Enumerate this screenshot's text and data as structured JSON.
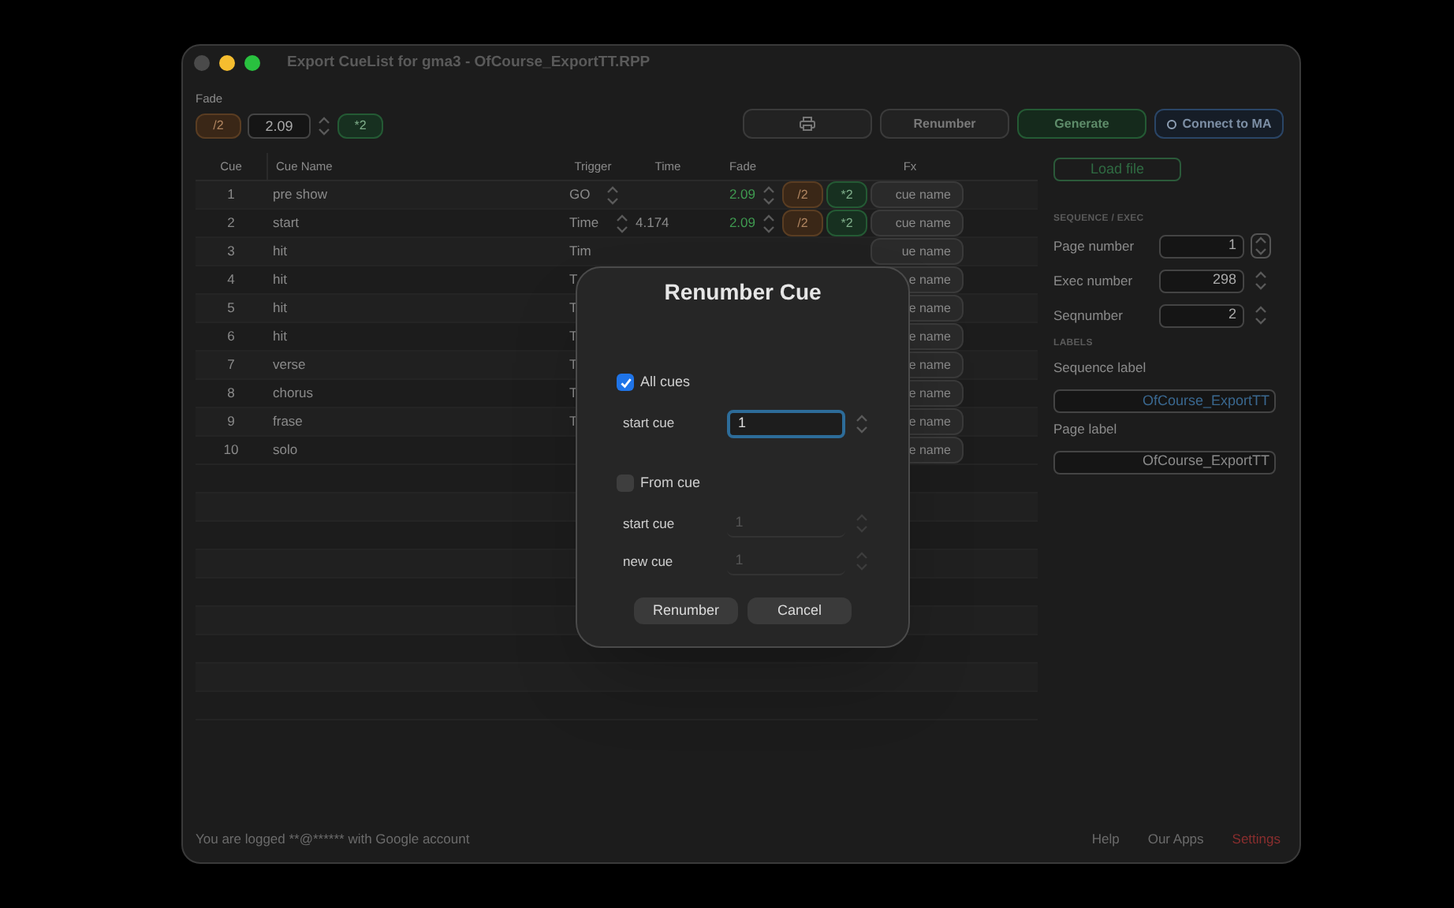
{
  "window": {
    "title": "Export CueList for gma3 - OfCourse_ExportTT.RPP"
  },
  "fade_bar": {
    "label": "Fade",
    "divide": "/2",
    "value": "2.09",
    "multiply": "*2"
  },
  "toolbar": [
    {
      "kind": "print"
    },
    {
      "kind": "plain",
      "label": "Renumber"
    },
    {
      "kind": "green",
      "label": "Generate"
    },
    {
      "kind": "blue",
      "label": "Connect to MA"
    }
  ],
  "table": {
    "columns": [
      "Cue",
      "Cue Name",
      "Trigger",
      "Time",
      "Fade",
      "Fx"
    ],
    "rows": [
      {
        "cue": "1",
        "name": "pre show",
        "trigger": "GO",
        "trigger_stepper": true,
        "fade": "2.09",
        "divide": "/2",
        "multiply": "*2",
        "fx": "cue name"
      },
      {
        "cue": "2",
        "name": "start",
        "trigger": "Time",
        "trigger_stepper": true,
        "time": "4.174",
        "fade": "2.09",
        "divide": "/2",
        "multiply": "*2",
        "fx": "cue name"
      },
      {
        "cue": "3",
        "name": "hit",
        "trigger": "Tim",
        "trigger_stepper": false,
        "fx": "ue name"
      },
      {
        "cue": "4",
        "name": "hit",
        "trigger": "T",
        "fx": "e name"
      },
      {
        "cue": "5",
        "name": "hit",
        "trigger": "T",
        "fx": "e name"
      },
      {
        "cue": "6",
        "name": "hit",
        "trigger": "T",
        "fx": "e name"
      },
      {
        "cue": "7",
        "name": "verse",
        "trigger": "T",
        "fx": "e name"
      },
      {
        "cue": "8",
        "name": "chorus",
        "trigger": "T",
        "fx": "e name"
      },
      {
        "cue": "9",
        "name": "frase",
        "trigger": "T",
        "fx": "e name"
      },
      {
        "cue": "10",
        "name": "solo",
        "fx": "e name"
      }
    ]
  },
  "side_panel": {
    "load_button": "Load file",
    "sequence_heading": "SEQUENCE / EXEC",
    "numbers": [
      {
        "label": "Page number",
        "value": "1",
        "focused": true
      },
      {
        "label": "Exec number",
        "value": "298",
        "focused": false
      },
      {
        "label": "Seqnumber",
        "value": "2",
        "focused": false
      }
    ],
    "labels_heading": "LABELS",
    "labels": [
      {
        "label": "Sequence label",
        "value": "OfCourse_ExportTT",
        "highlighted": true
      },
      {
        "label": "Page label",
        "value": "OfCourse_ExportTT",
        "highlighted": false
      }
    ]
  },
  "dialog": {
    "title": "Renumber Cue",
    "options": [
      {
        "label": "All cues",
        "checked": true,
        "fields": [
          {
            "label": "start cue",
            "value": "1",
            "disabled": false
          }
        ]
      },
      {
        "label": "From cue",
        "checked": false,
        "fields": [
          {
            "label": "start cue",
            "value": "1",
            "disabled": true
          },
          {
            "label": "new cue",
            "value": "1",
            "disabled": true
          }
        ]
      }
    ],
    "buttons": [
      "Renumber",
      "Cancel"
    ]
  },
  "status_bar": {
    "text": "You are logged **@****** with Google account",
    "links": [
      {
        "label": "Help",
        "color": "#6b6b6b"
      },
      {
        "label": "Our Apps",
        "color": "#6b6b6b"
      },
      {
        "label": "Settings",
        "color": "#8a2e2e"
      }
    ]
  }
}
